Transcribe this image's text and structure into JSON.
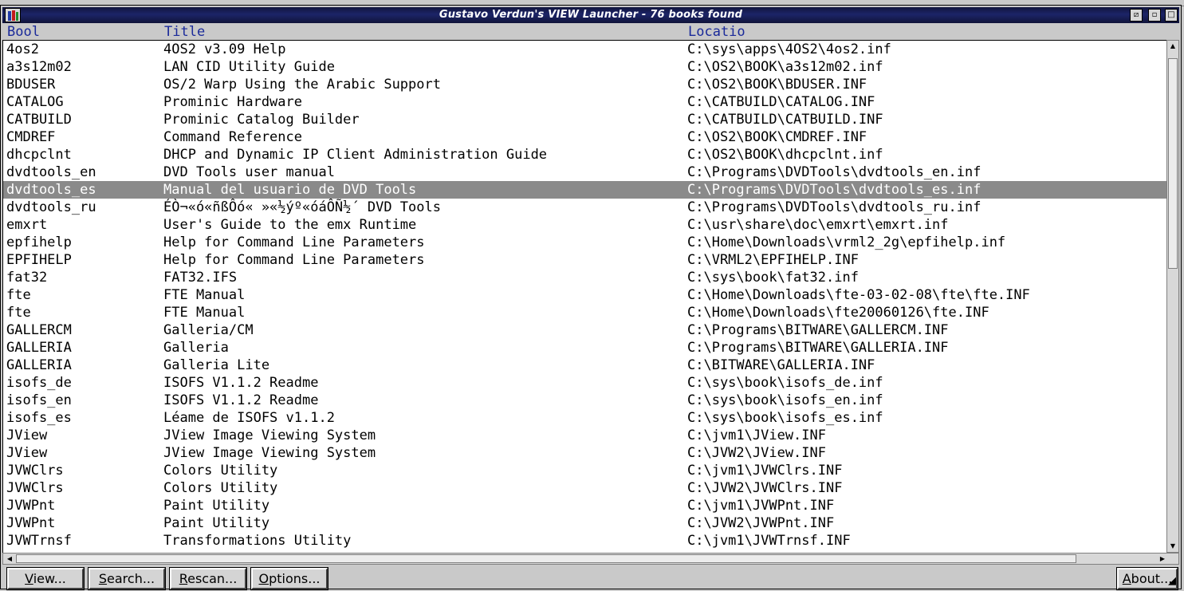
{
  "window": {
    "title": "Gustavo Verdun's VIEW Launcher - 76 books found",
    "controls": {
      "restore": "⧄",
      "minimize": "▫",
      "maximize": "□"
    }
  },
  "columns": {
    "book": "Bool",
    "title": "Title",
    "location": "Locatio"
  },
  "rows": [
    {
      "book": "4os2",
      "title": "4OS2 v3.09 Help",
      "location": "C:\\sys\\apps\\4OS2\\4os2.inf"
    },
    {
      "book": "a3s12m02",
      "title": "LAN CID Utility Guide",
      "location": "C:\\OS2\\BOOK\\a3s12m02.inf"
    },
    {
      "book": "BDUSER",
      "title": "OS/2 Warp Using the Arabic Support",
      "location": "C:\\OS2\\BOOK\\BDUSER.INF"
    },
    {
      "book": "CATALOG",
      "title": "Prominic Hardware",
      "location": "C:\\CATBUILD\\CATALOG.INF"
    },
    {
      "book": "CATBUILD",
      "title": "Prominic Catalog Builder",
      "location": "C:\\CATBUILD\\CATBUILD.INF"
    },
    {
      "book": "CMDREF",
      "title": "Command Reference",
      "location": "C:\\OS2\\BOOK\\CMDREF.INF"
    },
    {
      "book": "dhcpclnt",
      "title": "DHCP and Dynamic IP Client Administration Guide",
      "location": "C:\\OS2\\BOOK\\dhcpclnt.inf"
    },
    {
      "book": "dvdtools_en",
      "title": "DVD Tools user manual",
      "location": "C:\\Programs\\DVDTools\\dvdtools_en.inf"
    },
    {
      "book": "dvdtools_es",
      "title": "Manual del usuario de DVD Tools",
      "location": "C:\\Programs\\DVDTools\\dvdtools_es.inf"
    },
    {
      "book": "dvdtools_ru",
      "title": "ÉÒ¬«ó«ñßÔó« »«½ýº«óáÔÑ½´ DVD Tools",
      "location": "C:\\Programs\\DVDTools\\dvdtools_ru.inf"
    },
    {
      "book": "emxrt",
      "title": "User's Guide to the emx Runtime",
      "location": "C:\\usr\\share\\doc\\emxrt\\emxrt.inf"
    },
    {
      "book": "epfihelp",
      "title": "Help for Command Line Parameters",
      "location": "C:\\Home\\Downloads\\vrml2_2g\\epfihelp.inf"
    },
    {
      "book": "EPFIHELP",
      "title": "Help for Command Line Parameters",
      "location": "C:\\VRML2\\EPFIHELP.INF"
    },
    {
      "book": "fat32",
      "title": "FAT32.IFS",
      "location": "C:\\sys\\book\\fat32.inf"
    },
    {
      "book": "fte",
      "title": "FTE Manual",
      "location": "C:\\Home\\Downloads\\fte-03-02-08\\fte\\fte.INF"
    },
    {
      "book": "fte",
      "title": "FTE Manual",
      "location": "C:\\Home\\Downloads\\fte20060126\\fte.INF"
    },
    {
      "book": "GALLERCM",
      "title": "Galleria/CM",
      "location": "C:\\Programs\\BITWARE\\GALLERCM.INF"
    },
    {
      "book": "GALLERIA",
      "title": "Galleria",
      "location": "C:\\Programs\\BITWARE\\GALLERIA.INF"
    },
    {
      "book": "GALLERIA",
      "title": "Galleria Lite",
      "location": "C:\\BITWARE\\GALLERIA.INF"
    },
    {
      "book": "isofs_de",
      "title": "ISOFS V1.1.2 Readme",
      "location": "C:\\sys\\book\\isofs_de.inf"
    },
    {
      "book": "isofs_en",
      "title": "ISOFS V1.1.2 Readme",
      "location": "C:\\sys\\book\\isofs_en.inf"
    },
    {
      "book": "isofs_es",
      "title": "Léame de ISOFS v1.1.2",
      "location": "C:\\sys\\book\\isofs_es.inf"
    },
    {
      "book": "JView",
      "title": "JView Image Viewing System",
      "location": "C:\\jvm1\\JView.INF"
    },
    {
      "book": "JView",
      "title": "JView Image Viewing System",
      "location": "C:\\JVW2\\JView.INF"
    },
    {
      "book": "JVWClrs",
      "title": "Colors Utility",
      "location": "C:\\jvm1\\JVWClrs.INF"
    },
    {
      "book": "JVWClrs",
      "title": "Colors Utility",
      "location": "C:\\JVW2\\JVWClrs.INF"
    },
    {
      "book": "JVWPnt",
      "title": "Paint Utility",
      "location": "C:\\jvm1\\JVWPnt.INF"
    },
    {
      "book": "JVWPnt",
      "title": "Paint Utility",
      "location": "C:\\JVW2\\JVWPnt.INF"
    },
    {
      "book": "JVWTrnsf",
      "title": "Transformations Utility",
      "location": "C:\\jvm1\\JVWTrnsf.INF"
    }
  ],
  "selected_row": 8,
  "buttons": {
    "view": {
      "mnemonic": "V",
      "rest": "iew..."
    },
    "search": {
      "mnemonic": "S",
      "rest": "earch..."
    },
    "rescan": {
      "mnemonic": "R",
      "rest": "escan..."
    },
    "options": {
      "mnemonic": "O",
      "rest": "ptions..."
    },
    "about": {
      "mnemonic": "A",
      "rest": "bout..."
    }
  },
  "colors": {
    "titlebar": "#1c2468",
    "header_text": "#1a2a9a",
    "selection": "#8a8a8a",
    "list_background": "#ffffff"
  }
}
